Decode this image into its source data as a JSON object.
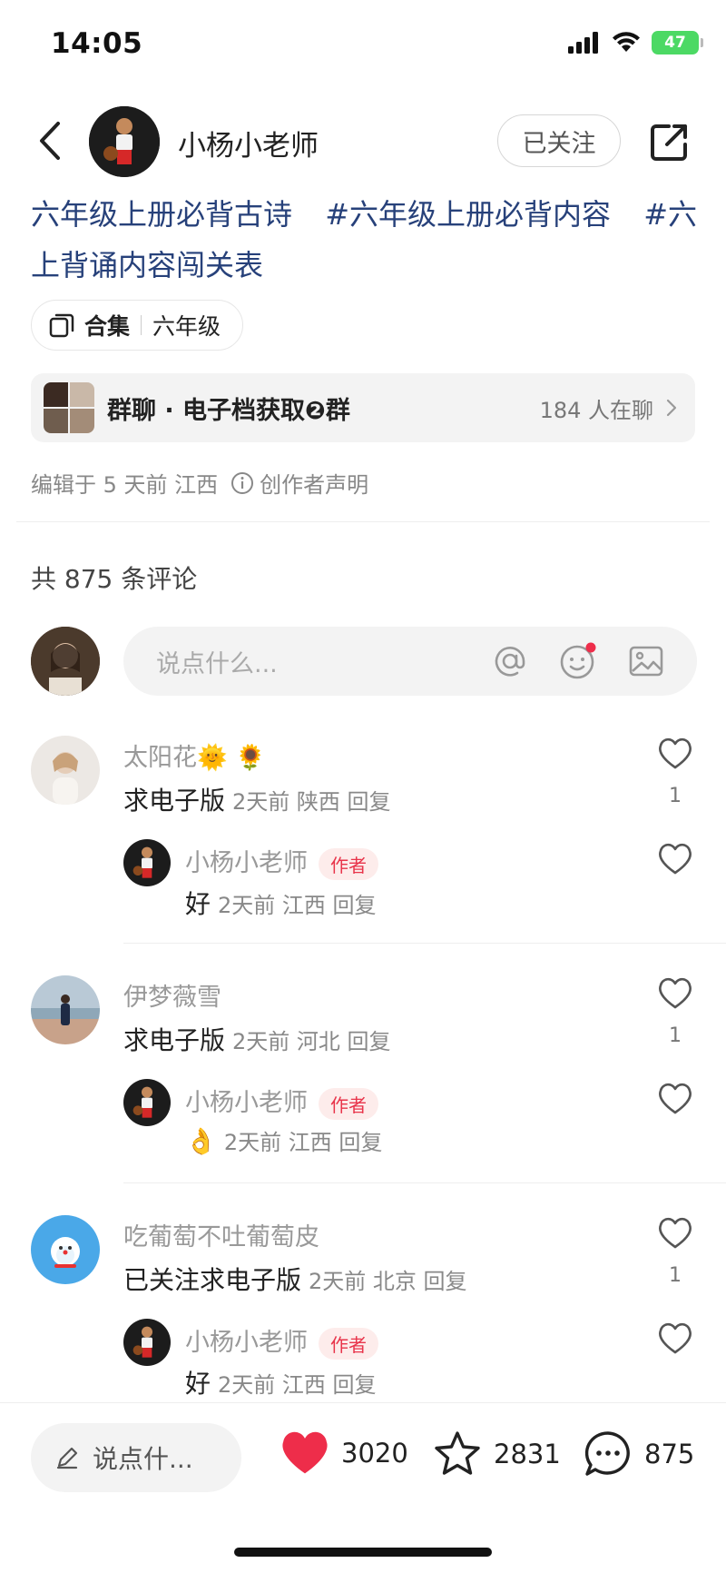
{
  "status_bar": {
    "time": "14:05",
    "battery": "47"
  },
  "header": {
    "author_name": "小杨小老师",
    "follow_label": "已关注"
  },
  "tags": [
    "六年级上册必背古诗",
    "#六年级上册必背内容",
    "#六上背诵内容闯关表"
  ],
  "collection": {
    "label": "合集",
    "name": "六年级"
  },
  "group_chat": {
    "title": "群聊 · 电子档获取❷群",
    "count": "184 人在聊"
  },
  "meta": {
    "edited": "编辑于 5 天前 江西",
    "declaration": "创作者声明"
  },
  "comments_header": {
    "count_text": "共 875 条评论"
  },
  "comment_input": {
    "placeholder": "说点什么..."
  },
  "comments": [
    {
      "name": "太阳花🌞 🌻",
      "text": "求电子版",
      "meta": "2天前 陕西 回复",
      "likes": "1",
      "reply": {
        "name": "小杨小老师",
        "badge": "作者",
        "text": "好",
        "meta": "2天前 江西 回复"
      }
    },
    {
      "name": "伊梦薇雪",
      "text": "求电子版",
      "meta": "2天前 河北 回复",
      "likes": "1",
      "reply": {
        "name": "小杨小老师",
        "badge": "作者",
        "text": "👌",
        "meta": "2天前 江西 回复"
      }
    },
    {
      "name": "吃葡萄不吐葡萄皮",
      "text": "已关注求电子版",
      "meta": "2天前 北京 回复",
      "likes": "1",
      "reply": {
        "name": "小杨小老师",
        "badge": "作者",
        "text": "好",
        "meta": "2天前 江西 回复"
      }
    }
  ],
  "bottom_bar": {
    "input_placeholder": "说点什...",
    "likes": "3020",
    "favorites": "2831",
    "comments": "875"
  },
  "colors": {
    "tag_blue": "#27417a",
    "like_red": "#ee2d4a",
    "author_badge": "#e8344a",
    "battery_green": "#4cd964"
  }
}
